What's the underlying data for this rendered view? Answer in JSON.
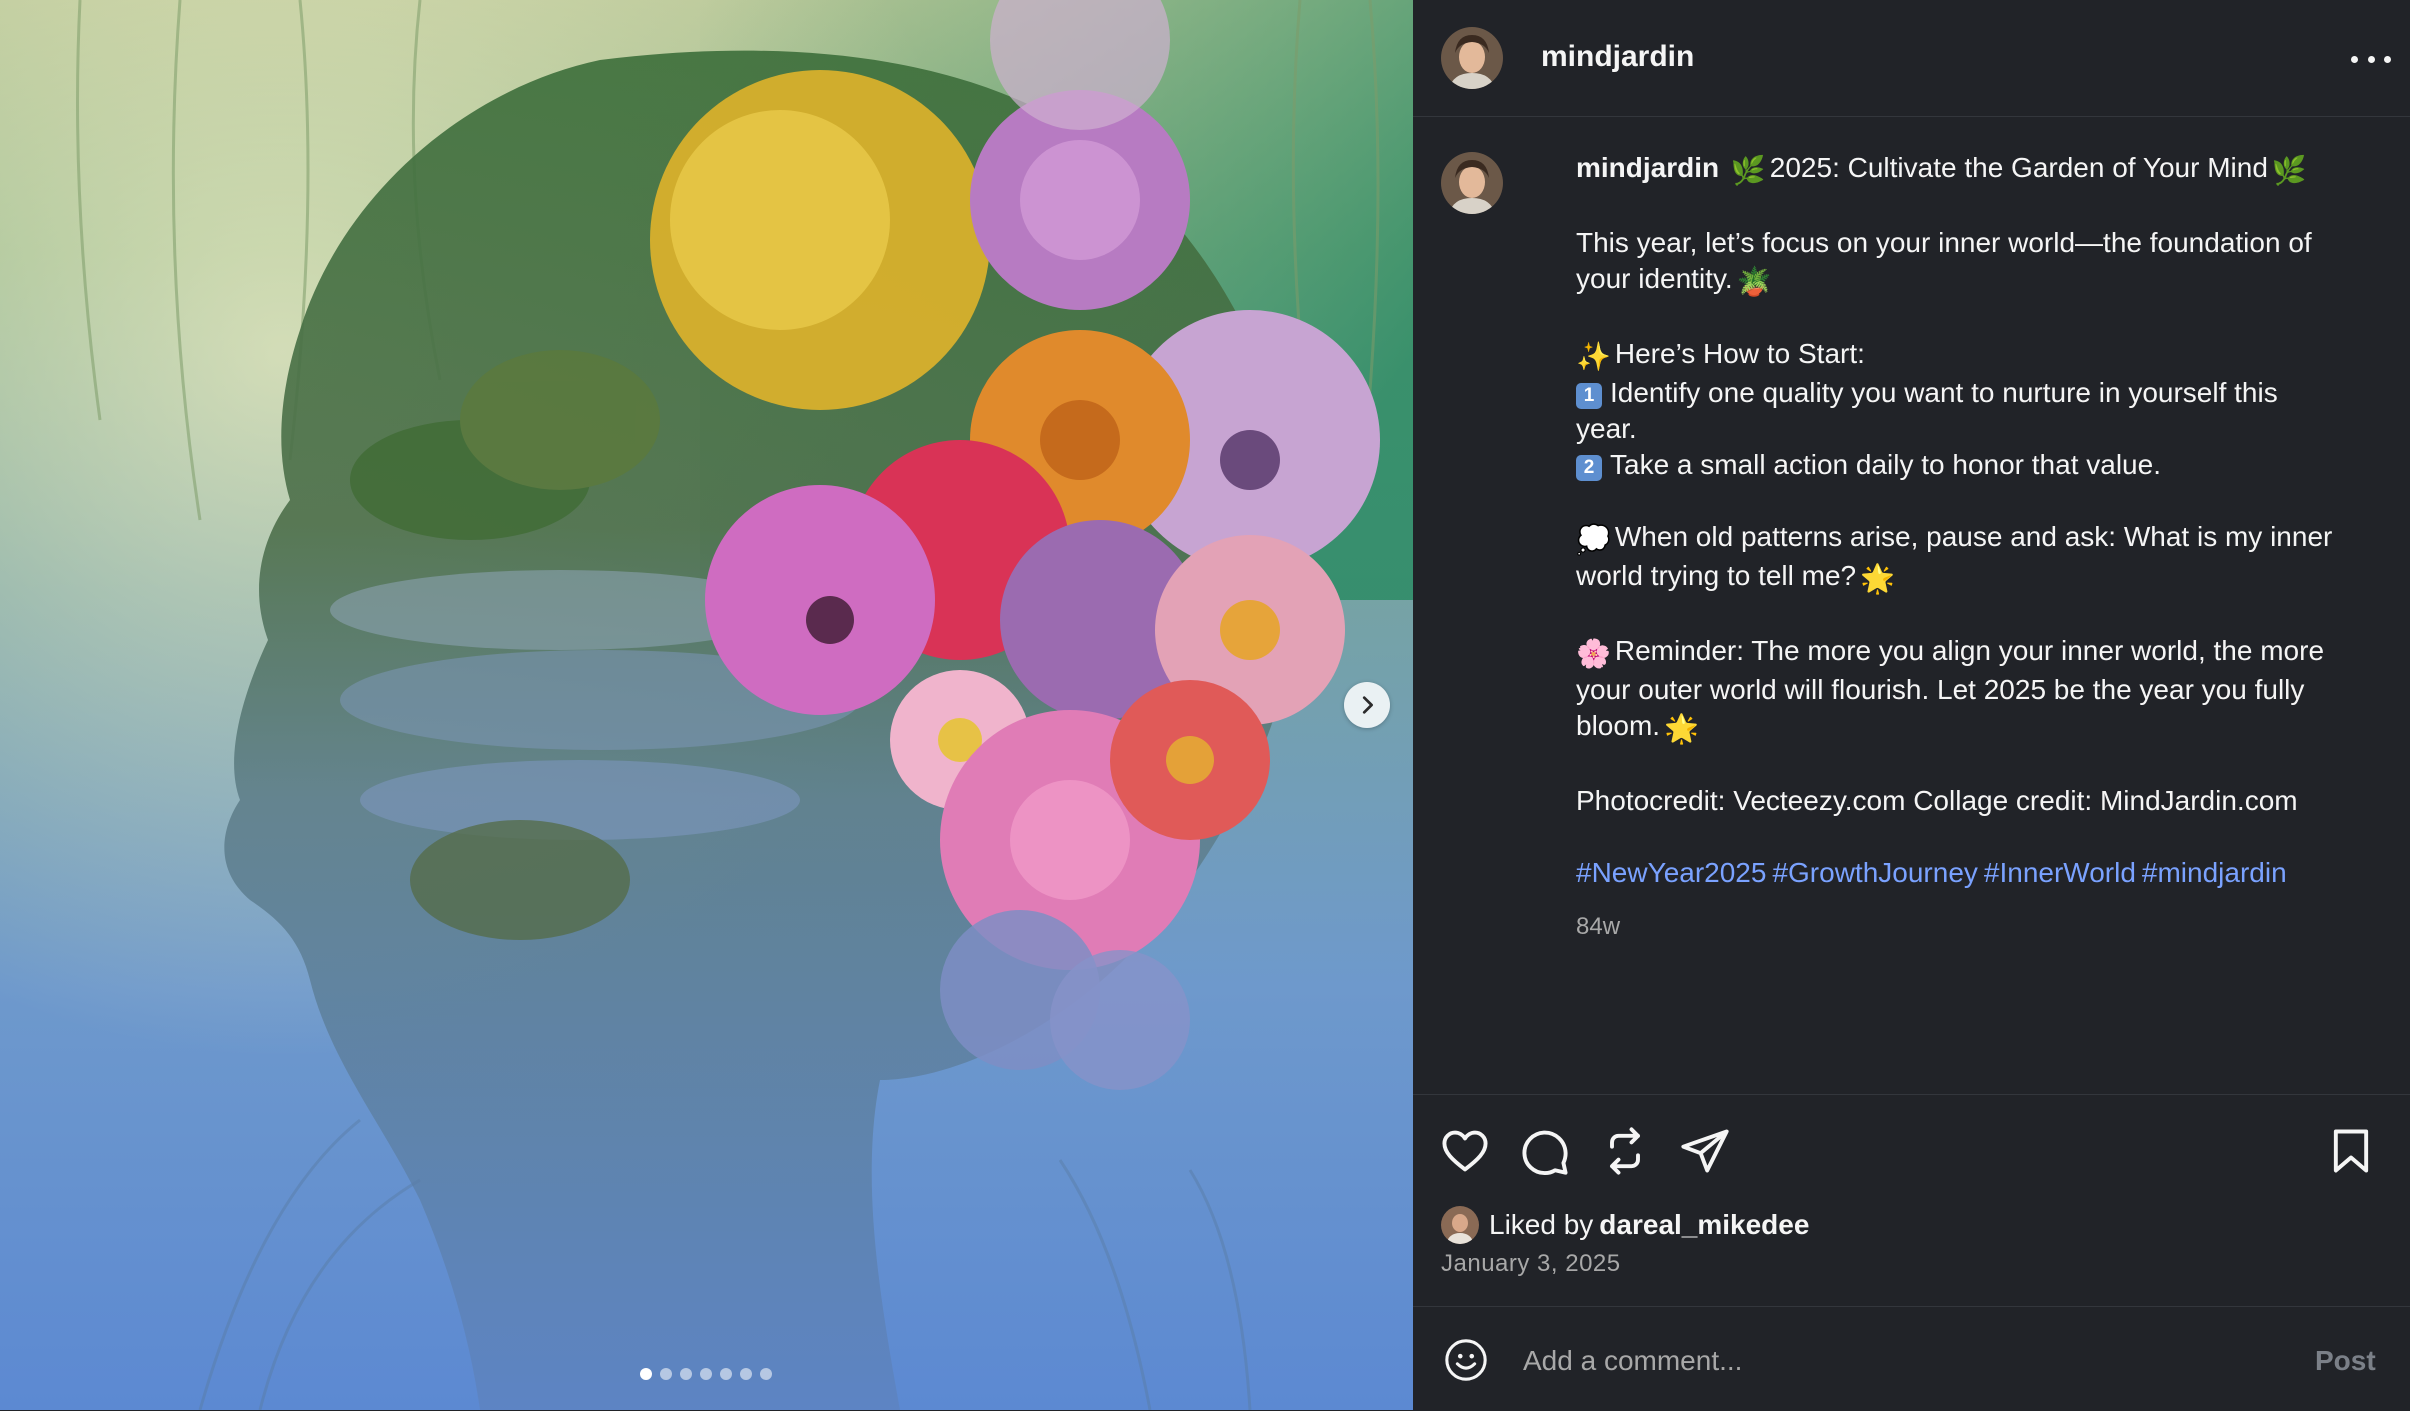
{
  "post": {
    "author": "mindjardin",
    "caption": {
      "title": "2025: Cultivate the Garden of Your Mind",
      "intro_line1": "This year, let’s focus on your inner world—the foundation of",
      "intro_line2": "your identity.",
      "how_to_start": "Here’s How to Start:",
      "step1_line1": "Identify one quality you want to nurture in yourself this",
      "step1_line2": "year.",
      "step2": "Take a small action daily to honor that value.",
      "patterns_line1": "When old patterns arise, pause and ask: What is my inner",
      "patterns_line2": "world trying to tell me?",
      "reminder_line1": "Reminder: The more you align your inner world, the more",
      "reminder_line2": "your outer world will flourish. Let 2025 be the year you fully",
      "reminder_line3": "bloom.",
      "credits": "Photocredit: Vecteezy.com Collage credit: MindJardin.com",
      "hashtags": [
        "#NewYear2025",
        "#GrowthJourney",
        "#InnerWorld",
        "#mindjardin"
      ],
      "age": "84w",
      "keycap1": "1",
      "keycap2": "2"
    },
    "likes": {
      "prefix": "Liked by",
      "user": "dareal_mikedee"
    },
    "date": "January 3, 2025",
    "carousel": {
      "total": 7,
      "current": 1
    }
  },
  "comment": {
    "placeholder": "Add a comment...",
    "post_label": "Post"
  },
  "icons": {
    "like": "heart-icon",
    "comment": "speech-bubble-icon",
    "repost": "repost-icon",
    "share": "paper-plane-icon",
    "save": "bookmark-icon",
    "emoji": "smiley-icon",
    "next": "chevron-right-icon",
    "more": "ellipsis-icon"
  },
  "colors": {
    "background": "#212328",
    "hashtag": "#7aa2ff",
    "muted": "#a8a8a8"
  }
}
